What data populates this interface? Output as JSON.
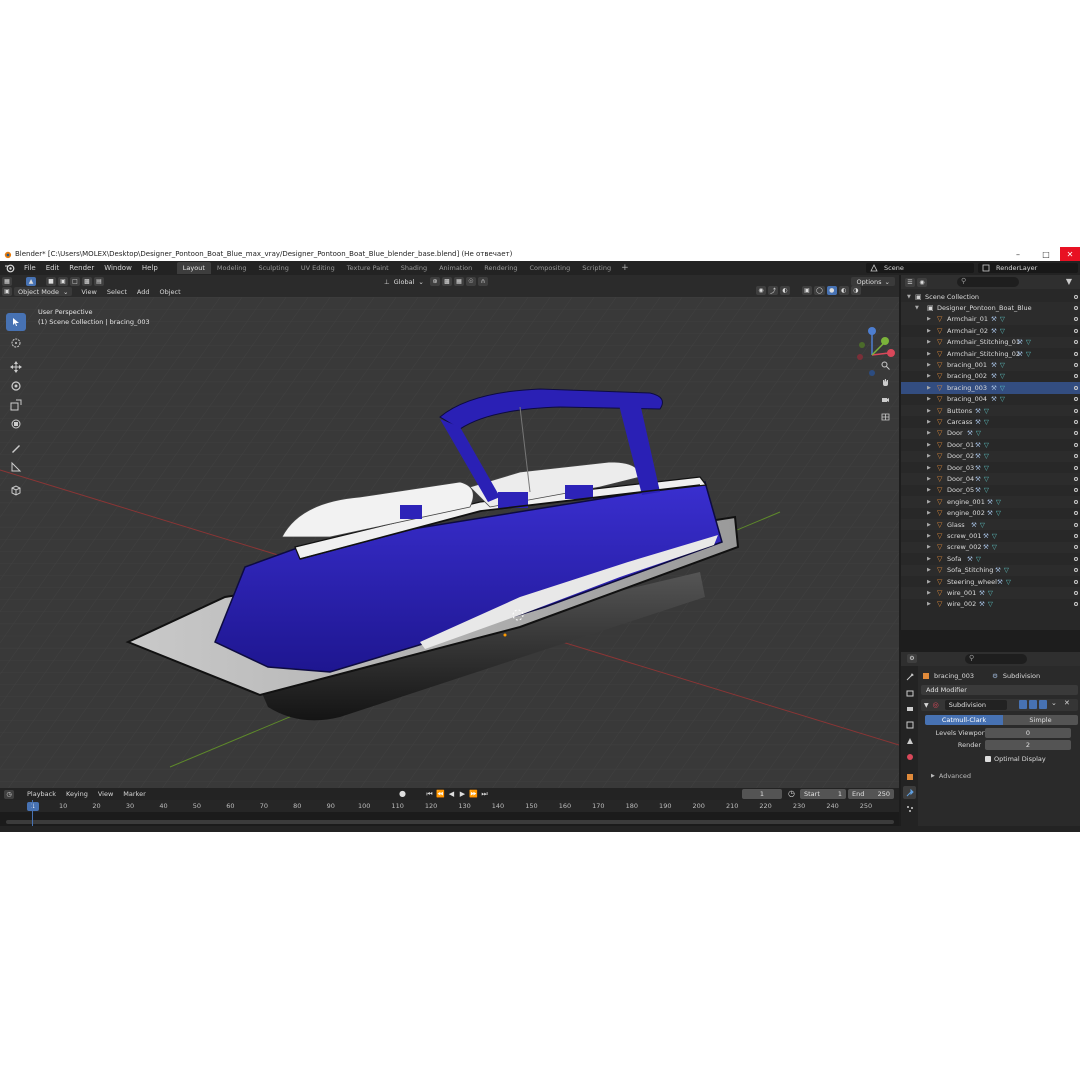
{
  "window": {
    "title": "Blender* [C:\\Users\\MOLEX\\Desktop\\Designer_Pontoon_Boat_Blue_max_vray/Designer_Pontoon_Boat_Blue_blender_base.blend] (Не отвечает)"
  },
  "menu": {
    "items": [
      "File",
      "Edit",
      "Render",
      "Window",
      "Help"
    ],
    "workspaces": [
      "Layout",
      "Modeling",
      "Sculpting",
      "UV Editing",
      "Texture Paint",
      "Shading",
      "Animation",
      "Rendering",
      "Compositing",
      "Scripting"
    ],
    "active_workspace": "Layout",
    "scene": "Scene",
    "render_layer": "RenderLayer"
  },
  "viewport": {
    "mode": "Object Mode",
    "menus": [
      "View",
      "Select",
      "Add",
      "Object"
    ],
    "orientation": "Global",
    "options": "Options",
    "perspective_label": "User Perspective",
    "collection_label": "(1) Scene Collection | bracing_003"
  },
  "timeline": {
    "menus": [
      "Playback",
      "Keying",
      "View",
      "Marker"
    ],
    "current_frame": "1",
    "start_label": "Start",
    "start": "1",
    "end_label": "End",
    "end": "250",
    "ticks": [
      "1",
      "10",
      "20",
      "30",
      "40",
      "50",
      "60",
      "70",
      "80",
      "90",
      "100",
      "110",
      "120",
      "130",
      "140",
      "150",
      "160",
      "170",
      "180",
      "190",
      "200",
      "210",
      "220",
      "230",
      "240",
      "250"
    ]
  },
  "outliner": {
    "root": "Scene Collection",
    "collection": "Designer_Pontoon_Boat_Blue",
    "items": [
      "Armchair_01",
      "Armchair_02",
      "Armchair_Stitching_01",
      "Armchair_Stitching_02",
      "bracing_001",
      "bracing_002",
      "bracing_003",
      "bracing_004",
      "Buttons",
      "Carcass",
      "Door",
      "Door_01",
      "Door_02",
      "Door_03",
      "Door_04",
      "Door_05",
      "engine_001",
      "engine_002",
      "Glass",
      "screw_001",
      "screw_002",
      "Sofa",
      "Sofa_Stitching",
      "Steering_wheel",
      "wire_001",
      "wire_002"
    ],
    "selected": "bracing_003"
  },
  "properties": {
    "object": "bracing_003",
    "modifier_context": "Subdivision",
    "add_modifier": "Add Modifier",
    "modifier_name": "Subdivision",
    "mode_catmull": "Catmull-Clark",
    "mode_simple": "Simple",
    "levels_viewport_label": "Levels Viewport",
    "levels_viewport": "0",
    "render_label": "Render",
    "render": "2",
    "optimal_display": "Optimal Display",
    "advanced": "Advanced"
  },
  "colors": {
    "accent": "#4772b3",
    "boat_blue": "#2b22b0",
    "object_orange": "#e08a3a",
    "modifier_cyan": "#5fc8c8"
  }
}
